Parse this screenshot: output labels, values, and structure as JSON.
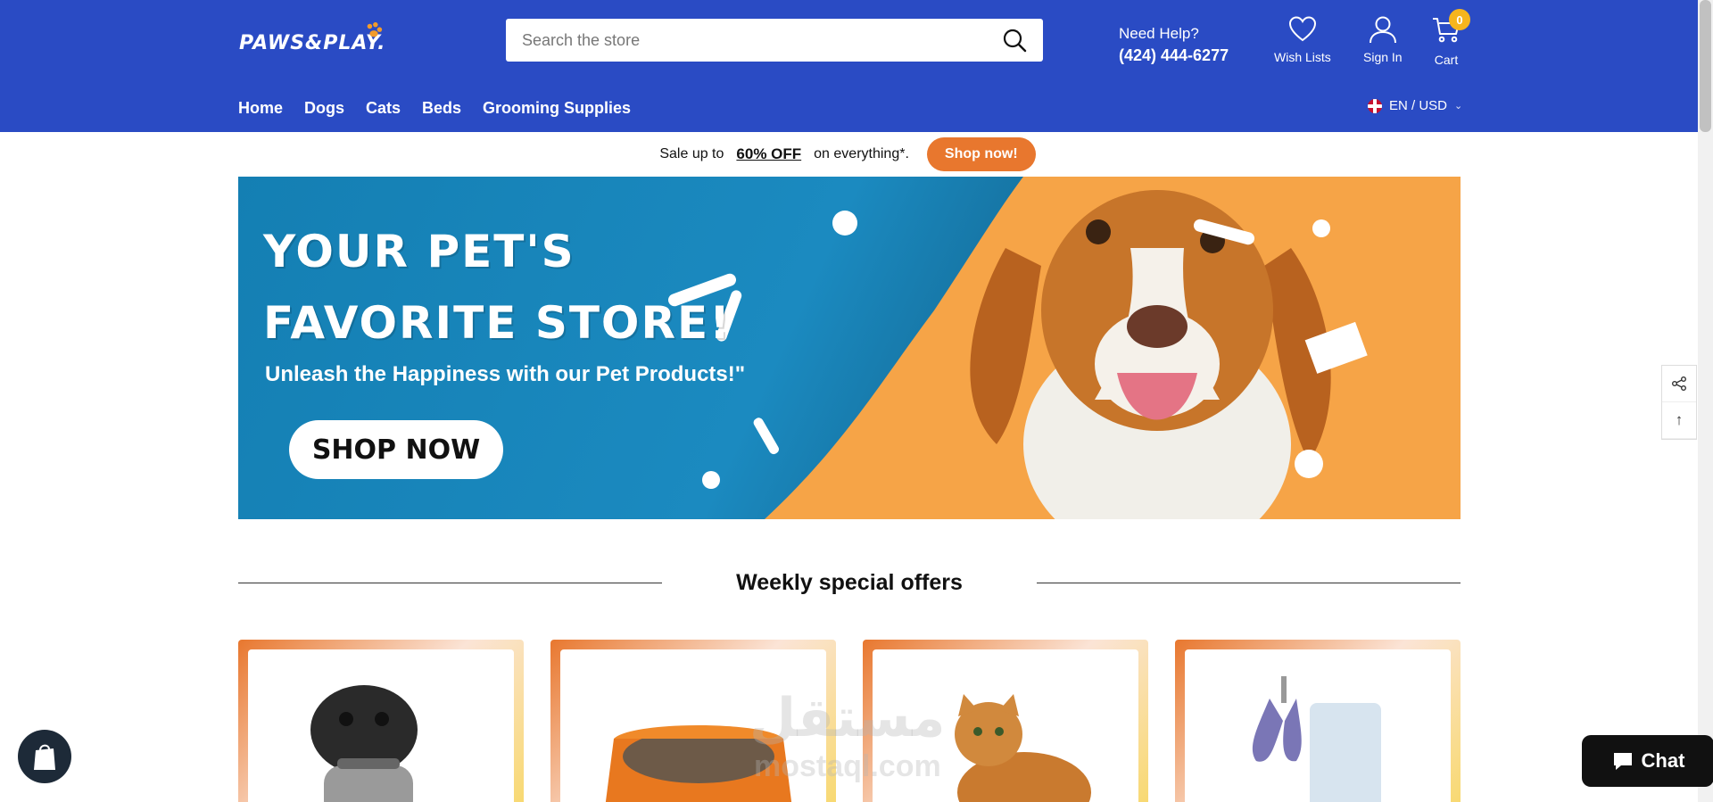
{
  "header": {
    "logo_text": "PAWS&PLAY.",
    "search_placeholder": "Search the store",
    "help_label": "Need Help?",
    "help_phone": "(424) 444-6277",
    "wish_label": "Wish Lists",
    "signin_label": "Sign In",
    "cart_label": "Cart",
    "cart_count": "0",
    "nav": [
      "Home",
      "Dogs",
      "Cats",
      "Beds",
      "Grooming Supplies"
    ],
    "locale": "EN / USD",
    "colors": {
      "brand": "#2a4bc4",
      "accent": "#e8772e"
    }
  },
  "salebar": {
    "before": "Sale up to",
    "percent": "60% OFF",
    "after": "on everything*.",
    "button": "Shop now!"
  },
  "hero": {
    "title_line1": "YOUR PET'S",
    "title_line2": "FAVORITE STORE!",
    "tagline": "Unleash the Happiness with our Pet Products!\"",
    "cta": "SHOP NOW"
  },
  "section": {
    "title": "Weekly special offers"
  },
  "products": [
    {
      "image": "pug-in-sweater"
    },
    {
      "image": "orange-dog-bed"
    },
    {
      "image": "tabby-cat"
    },
    {
      "image": "pet-nail-clipper"
    }
  ],
  "widgets": {
    "chat_label": "Chat",
    "watermark_ar": "مستقل",
    "watermark_en": "mostaql.com"
  }
}
